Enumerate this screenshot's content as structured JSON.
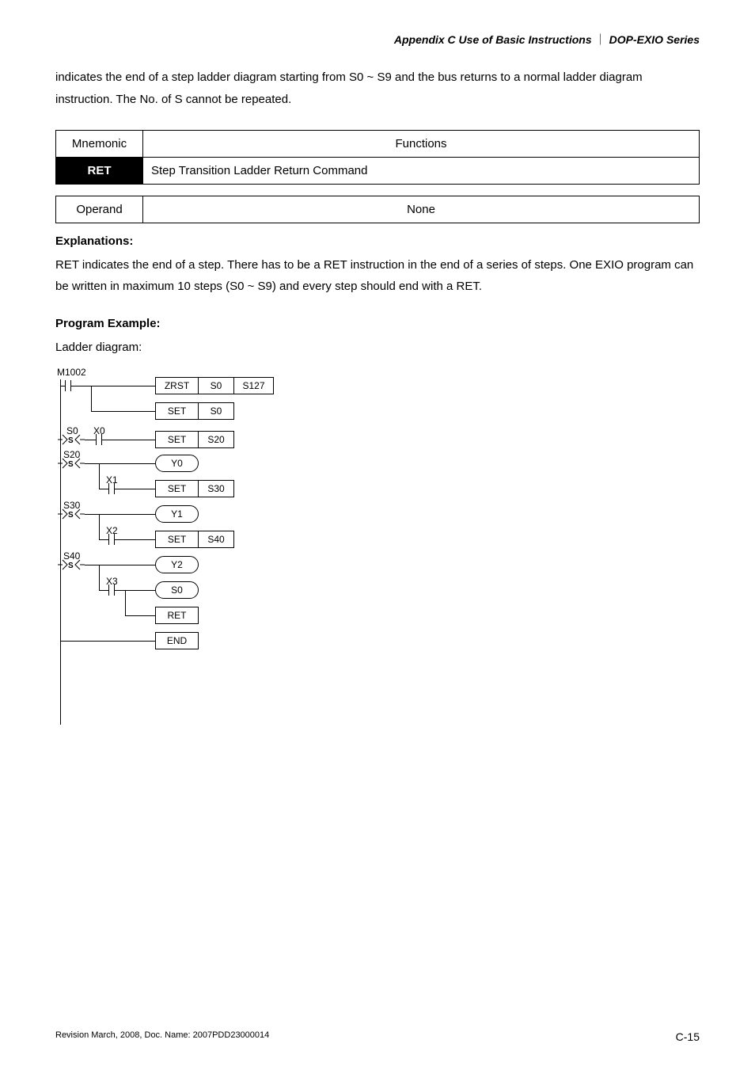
{
  "header": {
    "appendix": "Appendix C Use of Basic Instructions",
    "series": "DOP-EXIO Series"
  },
  "intro": "indicates the end of a step ladder diagram starting from S0 ~ S9 and the bus returns to a normal ladder diagram instruction. The No. of S cannot be repeated.",
  "table1": {
    "mnemonic_h": "Mnemonic",
    "functions_h": "Functions",
    "ret": "RET",
    "ret_desc": "Step Transition Ladder Return Command"
  },
  "table2": {
    "operand_h": "Operand",
    "none": "None"
  },
  "explanations_h": "Explanations:",
  "explanations": "RET indicates the end of a step. There has to be a RET instruction in the end of a series of steps. One EXIO program can be written in maximum 10 steps (S0 ~ S9) and every step should end with a RET.",
  "program_h": "Program Example:",
  "ladder_caption": "Ladder diagram:",
  "ladder": {
    "m1002": "M1002",
    "zrst": "ZRST",
    "s0": "S0",
    "s127": "S127",
    "set": "SET",
    "s20": "S20",
    "x0": "X0",
    "y0": "Y0",
    "x1": "X1",
    "s30": "S30",
    "y1": "Y1",
    "x2": "X2",
    "s40": "S40",
    "y2": "Y2",
    "x3": "X3",
    "ret": "RET",
    "end": "END",
    "S": "S"
  },
  "footer": {
    "rev": "Revision March, 2008, Doc. Name: 2007PDD23000014",
    "page": "C-15"
  }
}
